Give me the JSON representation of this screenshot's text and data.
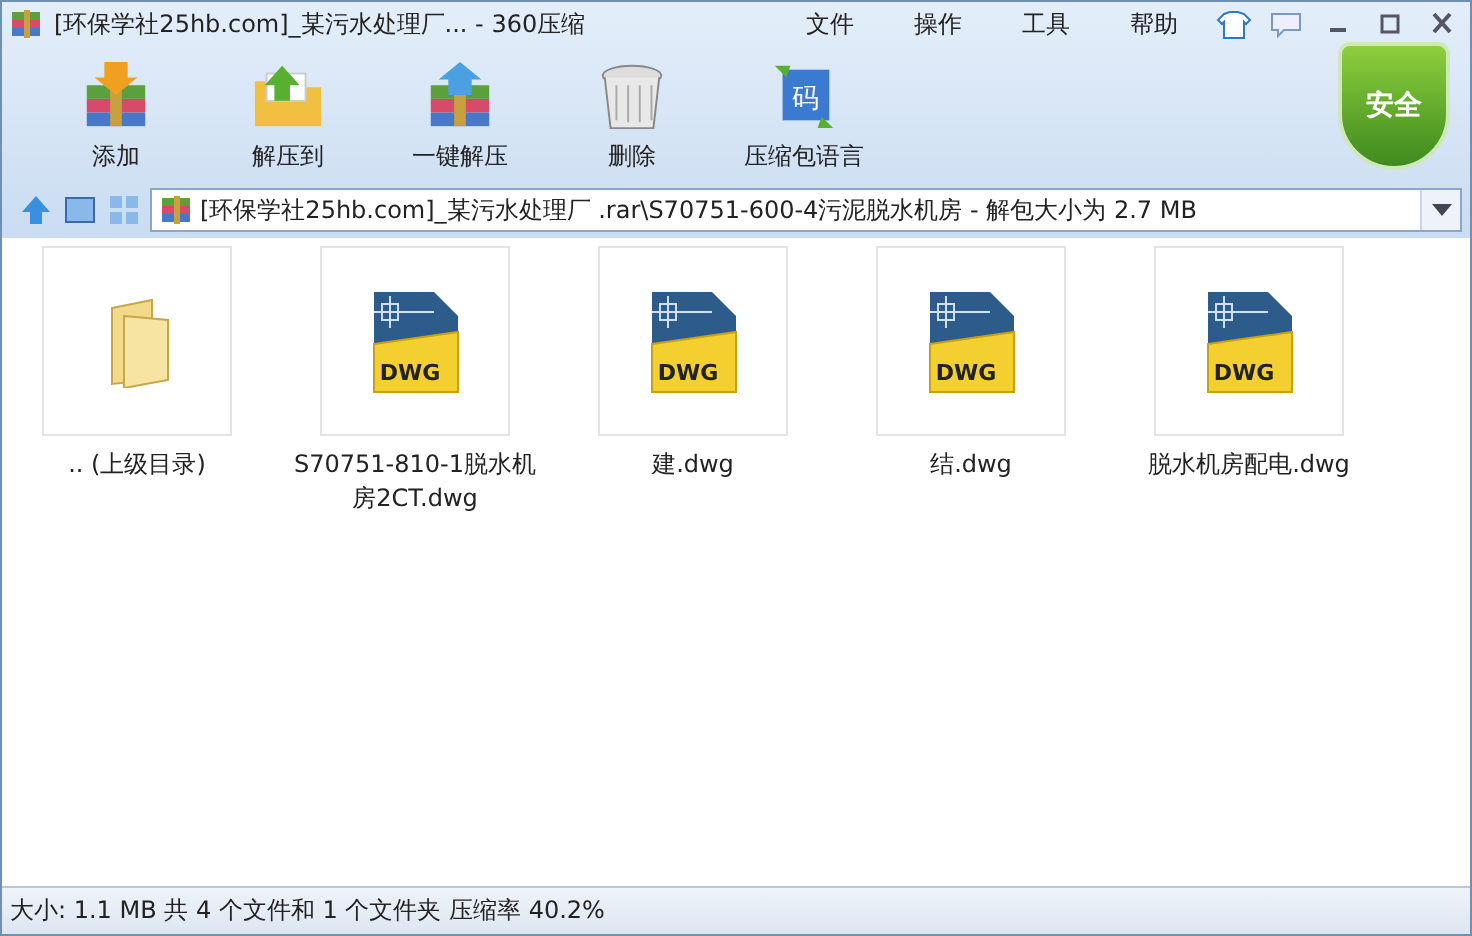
{
  "window": {
    "title": "[环保学社25hb.com]_某污水处理厂... - 360压缩"
  },
  "menu": [
    "文件",
    "操作",
    "工具",
    "帮助"
  ],
  "toolbar": [
    {
      "label": "添加",
      "kind": "add"
    },
    {
      "label": "解压到",
      "kind": "extract"
    },
    {
      "label": "一键解压",
      "kind": "oneclick"
    },
    {
      "label": "删除",
      "kind": "delete"
    },
    {
      "label": "压缩包语言",
      "kind": "language",
      "glyph": "码"
    }
  ],
  "security_badge": "安全",
  "address": {
    "path": "[环保学社25hb.com]_某污水处理厂 .rar\\S70751-600-4污泥脱水机房 - 解包大小为 2.7 MB"
  },
  "files": [
    {
      "name": ".. (上级目录)",
      "kind": "folder"
    },
    {
      "name": "S70751-810-1脱水机房2CT.dwg",
      "kind": "dwg",
      "badge": "DWG"
    },
    {
      "name": "建.dwg",
      "kind": "dwg",
      "badge": "DWG"
    },
    {
      "name": "结.dwg",
      "kind": "dwg",
      "badge": "DWG"
    },
    {
      "name": "脱水机房配电.dwg",
      "kind": "dwg",
      "badge": "DWG"
    }
  ],
  "status_bar": "大小: 1.1 MB 共 4 个文件和 1 个文件夹 压缩率 40.2%"
}
